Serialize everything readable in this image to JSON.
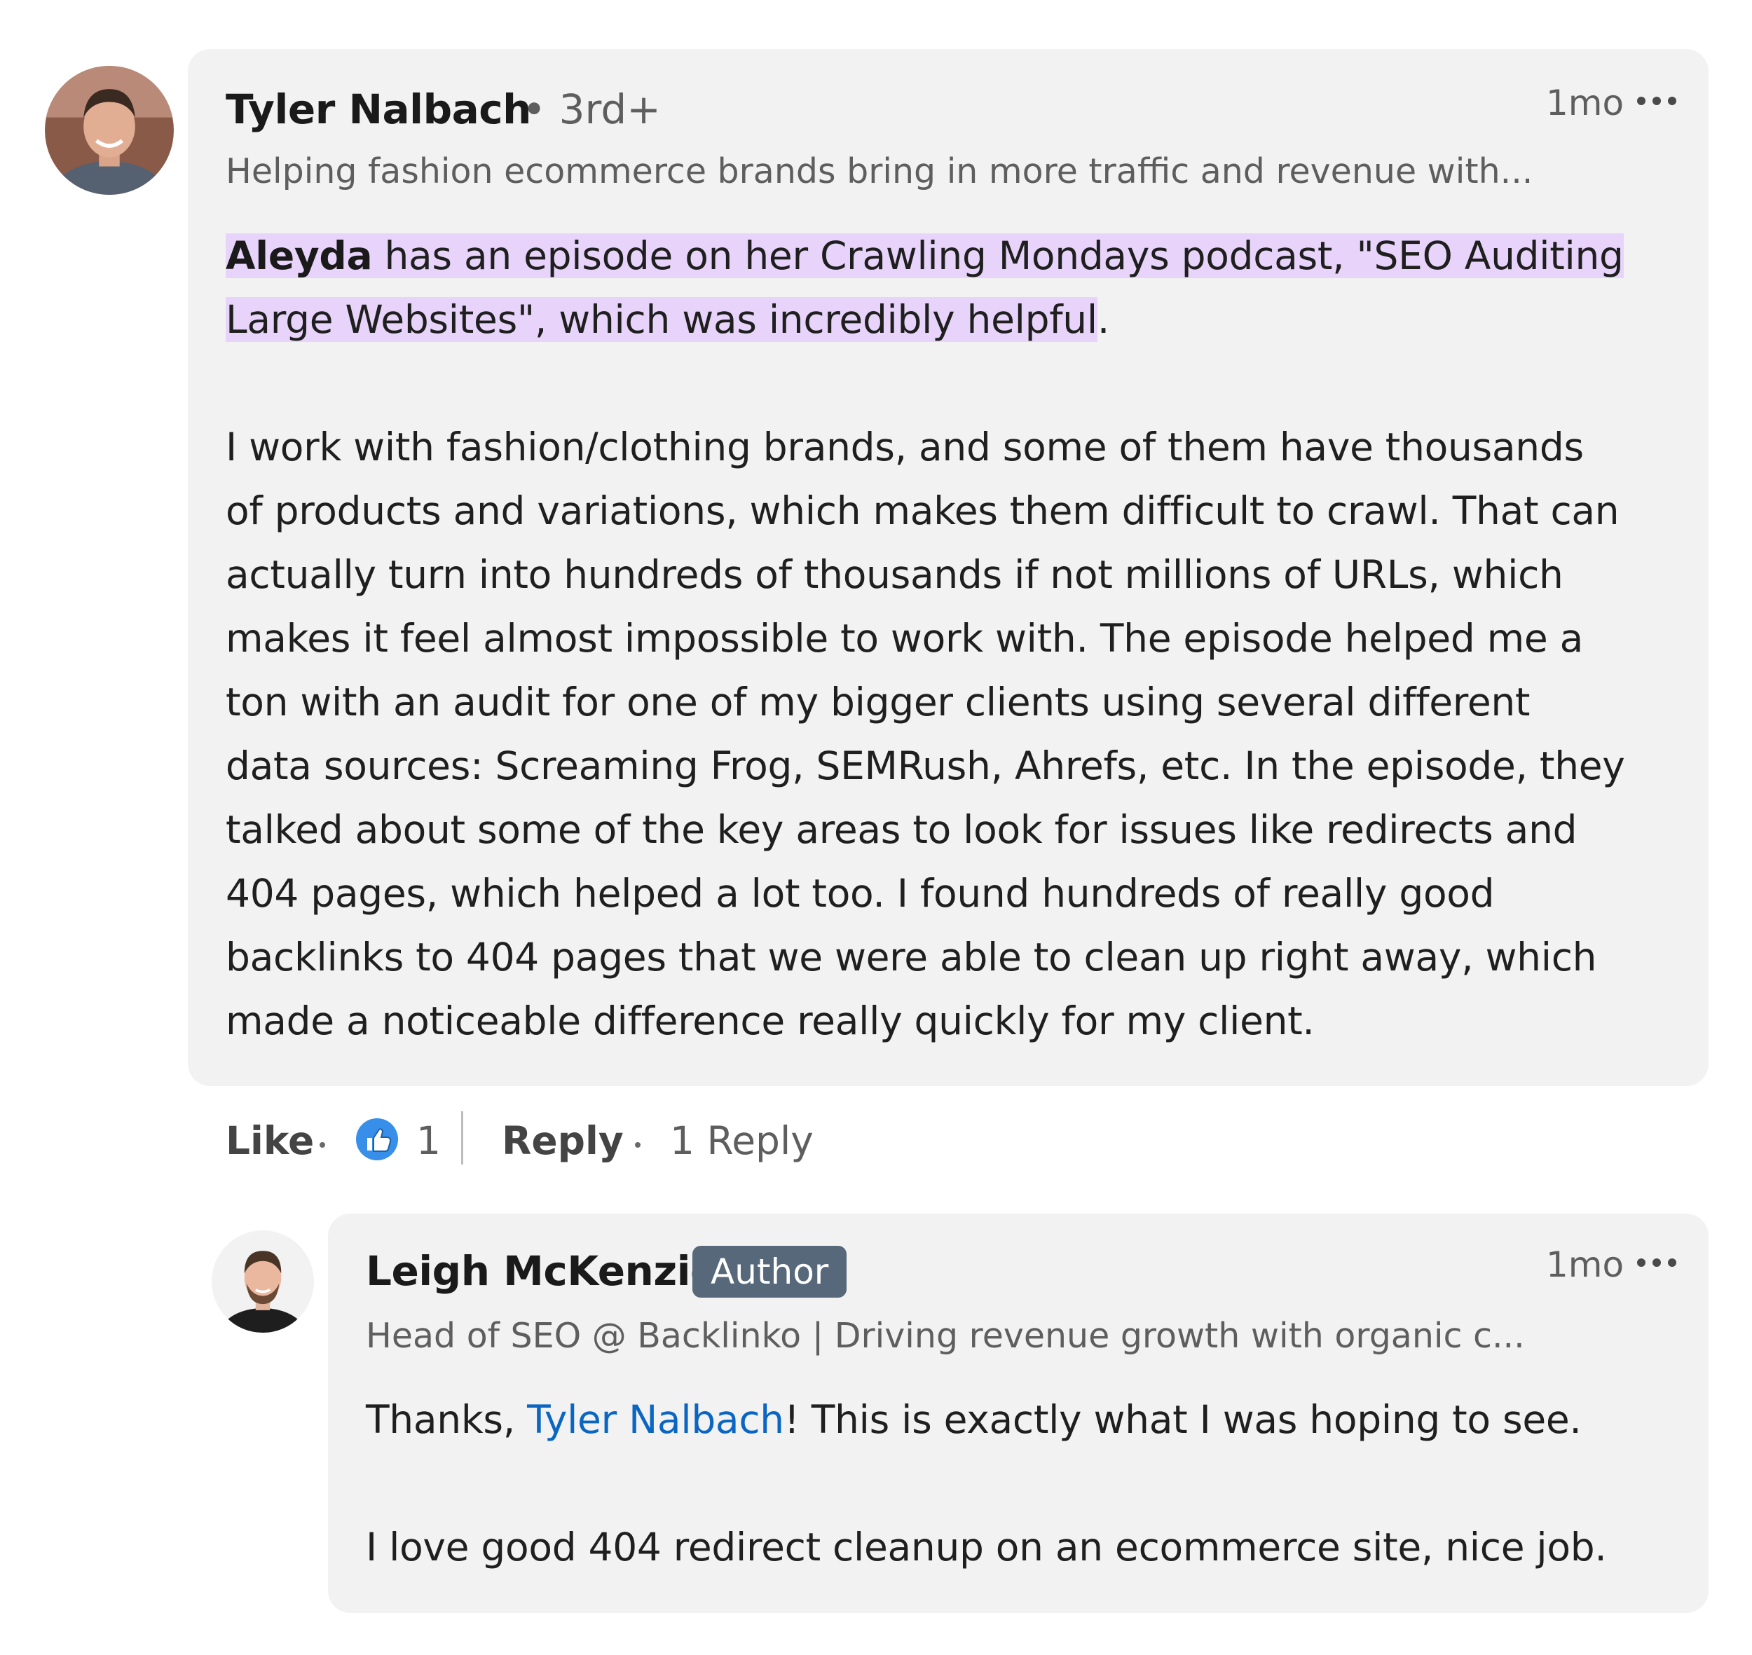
{
  "comment": {
    "author_name": "Tyler Nalbach",
    "degree": "• 3rd+",
    "timestamp": "1mo",
    "headline": "Helping fashion ecommerce brands bring in more traffic and revenue with...",
    "body_line1_mention": "Aleyda",
    "body_line1_rest": " has an episode on her Crawling Mondays podcast, \"SEO Auditing",
    "body_line2_highlight": "Large Websites\", which was incredibly helpful",
    "body_line2_end": ".",
    "body_paragraph2": [
      "I work with fashion/clothing brands, and some of them have thousands",
      "of products and variations, which makes them difficult to crawl. That can",
      "actually turn into hundreds of thousands if not millions of URLs, which",
      "makes it feel almost impossible to work with. The episode helped me a",
      "ton with an audit for one of my bigger clients using several different",
      "data sources: Screaming Frog, SEMRush, Ahrefs, etc. In the episode, they",
      "talked about some of the key areas to look for issues like redirects and",
      "404 pages, which helped a lot too. I found hundreds of really good",
      "backlinks to 404 pages that we were able to clean up right away, which",
      "made a noticeable difference really quickly for my client."
    ]
  },
  "actions": {
    "like_label": "Like",
    "reaction_count": "1",
    "reply_label": "Reply",
    "replies_count_label": "1 Reply"
  },
  "reply": {
    "author_name": "Leigh McKenzie",
    "badge": "Author",
    "timestamp": "1mo",
    "headline": "Head of SEO @ Backlinko | Driving revenue growth with organic c...",
    "line1_start": "Thanks, ",
    "line1_mention": "Tyler Nalbach",
    "line1_end": "! This is exactly what I was hoping to see.",
    "line2": "I love good 404 redirect cleanup on an ecommerce site, nice job."
  },
  "colors": {
    "bubble_bg": "#f2f2f2",
    "highlight": "#e8d4fb",
    "link": "#0a66c2",
    "badge_bg": "#56687a",
    "like_icon": "#378fe9"
  },
  "icons": [
    "profile-avatar",
    "more-options-icon",
    "like-reaction-icon"
  ]
}
